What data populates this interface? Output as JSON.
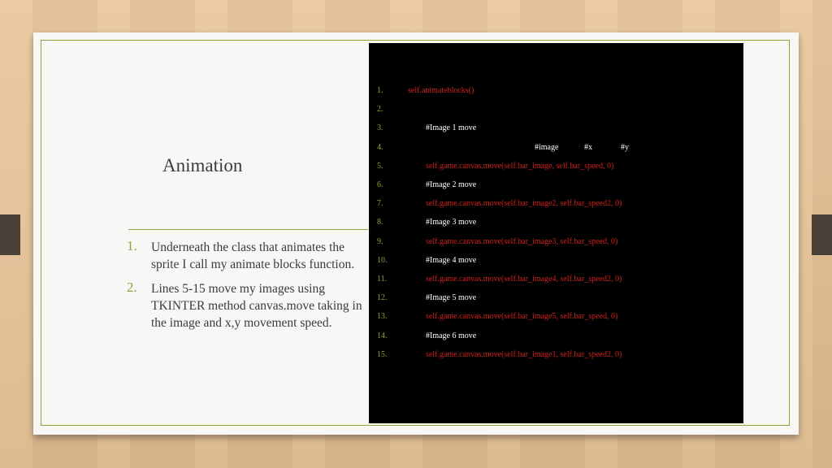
{
  "slide": {
    "title": "Animation",
    "bullets": [
      {
        "num": "1.",
        "text": "Underneath the class that animates the sprite I call my animate blocks function."
      },
      {
        "num": "2.",
        "text": "Lines 5-15 move my images using TKINTER method canvas.move taking in the image and x,y movement speed."
      }
    ]
  },
  "code": {
    "lines": [
      {
        "num": "1.",
        "text": "self.animateblocks()",
        "color": "red"
      },
      {
        "num": "2.",
        "text": "",
        "color": "white"
      },
      {
        "num": "3.",
        "text": "#Image 1 move",
        "color": "white"
      },
      {
        "num": "4.",
        "text": "",
        "color": "white",
        "comments": [
          "#image",
          "#x",
          "#y"
        ]
      },
      {
        "num": "5.",
        "text": "self.game.canvas.move(self.bar_image, self.bar_speed, 0)",
        "color": "red"
      },
      {
        "num": "6.",
        "text": "#Image 2 move",
        "color": "white"
      },
      {
        "num": "7.",
        "text": "self.game.canvas.move(self.bar_image2, self.bar_speed2, 0)",
        "color": "red"
      },
      {
        "num": "8.",
        "text": "#Image 3 move",
        "color": "white"
      },
      {
        "num": "9.",
        "text": "self.game.canvas.move(self.bar_image3, self.bar_speed, 0)",
        "color": "red"
      },
      {
        "num": "10.",
        "text": "#Image 4 move",
        "color": "white"
      },
      {
        "num": "11.",
        "text": "self.game.canvas.move(self.bar_image4, self.bar_speed2, 0)",
        "color": "red"
      },
      {
        "num": "12.",
        "text": "#Image 5 move",
        "color": "white"
      },
      {
        "num": "13.",
        "text": "self.game.canvas.move(self.bar_image5, self.bar_speed, 0)",
        "color": "red"
      },
      {
        "num": "14.",
        "text": "#Image 6 move",
        "color": "white"
      },
      {
        "num": "15.",
        "text": "self.game.canvas.move(self.bar_image1, self.bar_speed2, 0)",
        "color": "red"
      }
    ]
  },
  "colors": {
    "accent": "#8ea33a",
    "code_red": "#d0201b",
    "code_bg": "#000000"
  }
}
